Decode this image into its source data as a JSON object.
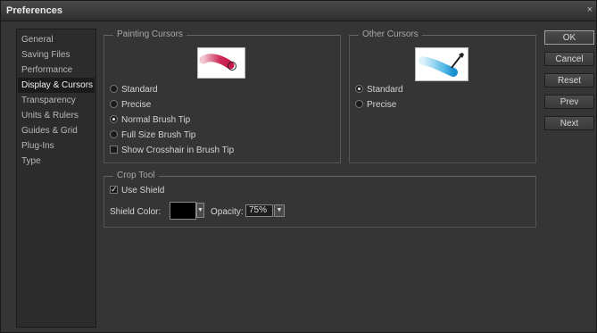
{
  "window": {
    "title": "Preferences",
    "close_glyph": "×"
  },
  "sidebar": {
    "items": [
      {
        "label": "General"
      },
      {
        "label": "Saving Files"
      },
      {
        "label": "Performance"
      },
      {
        "label": "Display & Cursors",
        "selected": true
      },
      {
        "label": "Transparency"
      },
      {
        "label": "Units & Rulers"
      },
      {
        "label": "Guides & Grid"
      },
      {
        "label": "Plug-Ins"
      },
      {
        "label": "Type"
      }
    ]
  },
  "painting_cursors": {
    "title": "Painting Cursors",
    "preview_icon": "brush-stroke-preview-icon",
    "options": [
      {
        "label": "Standard",
        "selected": false
      },
      {
        "label": "Precise",
        "selected": false
      },
      {
        "label": "Normal Brush Tip",
        "selected": true
      },
      {
        "label": "Full Size Brush Tip",
        "selected": false
      }
    ],
    "crosshair": {
      "label": "Show Crosshair in Brush Tip",
      "checked": false
    }
  },
  "other_cursors": {
    "title": "Other Cursors",
    "preview_icon": "eyedropper-preview-icon",
    "options": [
      {
        "label": "Standard",
        "selected": true
      },
      {
        "label": "Precise",
        "selected": false
      }
    ]
  },
  "crop_tool": {
    "title": "Crop Tool",
    "use_shield": {
      "label": "Use Shield",
      "checked": true
    },
    "shield_color_label": "Shield Color:",
    "shield_color": "#000000",
    "opacity_label": "Opacity:",
    "opacity_value": "75%"
  },
  "buttons": {
    "ok": "OK",
    "cancel": "Cancel",
    "reset": "Reset",
    "prev": "Prev",
    "next": "Next"
  },
  "colors": {
    "brush_stroke": "#c8174a",
    "eyedropper_stroke": "#2aa7e0"
  }
}
